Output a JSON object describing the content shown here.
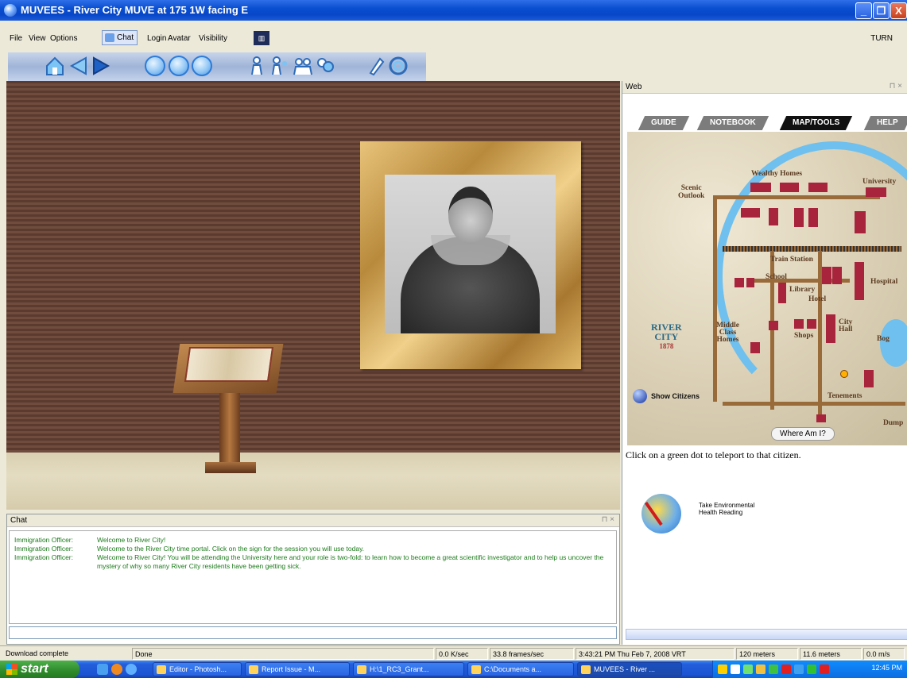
{
  "window": {
    "title": "MUVEES - River City MUVE at 175 1W facing E",
    "controls": [
      "_",
      "❐",
      "X"
    ]
  },
  "menu": {
    "items": [
      "File",
      "View",
      "Options",
      "Chat",
      "Login",
      "Avatar",
      "Visibility"
    ],
    "turn": "TURN"
  },
  "toolbar": {
    "icons": [
      "home-icon",
      "back-arrow-icon",
      "forward-arrow-icon",
      "circle-1-icon",
      "circle-2-icon",
      "circle-3-icon",
      "person-icon",
      "person-2-icon",
      "group-icon",
      "group-2-icon",
      "tool-icon",
      "swirl-icon"
    ]
  },
  "chat": {
    "title": "Chat",
    "messages": [
      {
        "who": "Immigration Officer:",
        "text": "Welcome to River City!"
      },
      {
        "who": "Immigration Officer:",
        "text": "Welcome to the River City time portal. Click on the sign for the session you will use today."
      },
      {
        "who": "Immigration Officer:",
        "text": "Welcome to River City! You will be attending the University here  and your role is two-fold: to learn how to become a great scientific investigator and to help us uncover the mystery of why so many River City residents have been getting sick."
      }
    ],
    "input": ""
  },
  "web": {
    "title": "Web",
    "tabs": [
      "GUIDE",
      "NOTEBOOK",
      "MAP/TOOLS",
      "HELP"
    ],
    "active_tab": "MAP/TOOLS",
    "map_labels": {
      "wealthy": "Wealthy  Homes",
      "university": "University",
      "scenic": "Scenic\nOutlook",
      "train": "Train Station",
      "school": "School",
      "library": "Library",
      "hotel": "Hotel",
      "hospital": "Hospital",
      "middle": "Middle\nClass\nHomes",
      "shops": "Shops",
      "city_hall": "City\nHall",
      "bog": "Bog",
      "tenements": "Tenements",
      "dump": "Dump",
      "river_city": "RIVER\nCITY",
      "year": "1878"
    },
    "show_citizens": "Show Citizens",
    "where_am_i": "Where Am I?",
    "teleport_text": "Click on a green dot to teleport to that citizen.",
    "env_reading": "Take Environmental\nHealth Reading"
  },
  "status": {
    "left": "Download complete",
    "done": "Done",
    "kbps": "0.0 K/sec",
    "fps": "33.8 frames/sec",
    "datetime": "3:43:21 PM Thu Feb 7, 2008 VRT",
    "dist1": "120 meters",
    "dist2": "11.6 meters",
    "speed": "0.0 m/s"
  },
  "taskbar": {
    "start": "start",
    "tasks": [
      "Editor - Photosh...",
      "Report Issue - M...",
      "H:\\1_RC3_Grant...",
      "C:\\Documents a...",
      "MUVEES - River ..."
    ],
    "clock": "12:45 PM"
  },
  "colors": {
    "titlebar": "#0a4fd0",
    "chat_text": "#1a7a1a",
    "wall": "#5c3b2f",
    "map_building": "#a8233c",
    "river": "#6fc0ee"
  }
}
